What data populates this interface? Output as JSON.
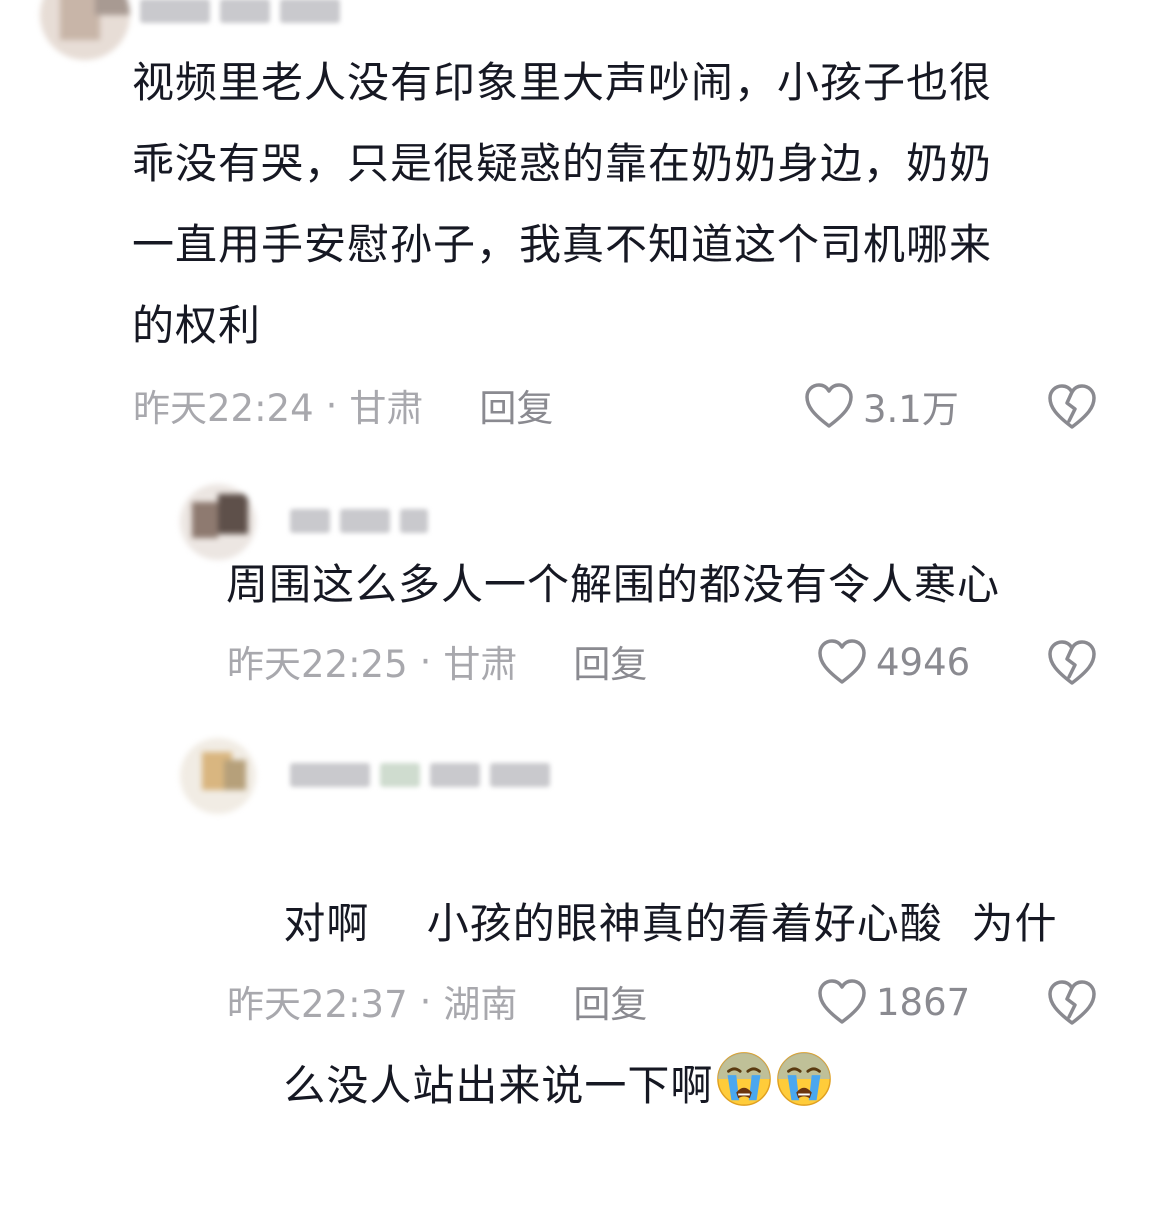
{
  "comments": [
    {
      "text": "视频里老人没有印象里大声吵闹，小孩子也很\n乖没有哭，只是很疑惑的靠在奶奶身边，奶奶\n一直用手安慰孙子，我真不知道这个司机哪来\n的权利",
      "time": "昨天22:24",
      "location": "甘肃",
      "reply_label": "回复",
      "likes": "3.1万"
    },
    {
      "text": "周围这么多人一个解围的都没有令人寒心",
      "time": "昨天22:25",
      "location": "甘肃",
      "reply_label": "回复",
      "likes": "4946"
    },
    {
      "text_line1": "对啊    小孩的眼神真的看着好心酸  为什",
      "text_line2": "么没人站出来说一下啊",
      "emoji": [
        "loudly-crying-face",
        "loudly-crying-face"
      ],
      "time": "昨天22:37",
      "location": "湖南",
      "reply_label": "回复",
      "likes": "1867"
    }
  ],
  "separator": "·",
  "colors": {
    "text": "#161823",
    "meta": "#a8a8ad",
    "icon": "#8a8a90"
  }
}
